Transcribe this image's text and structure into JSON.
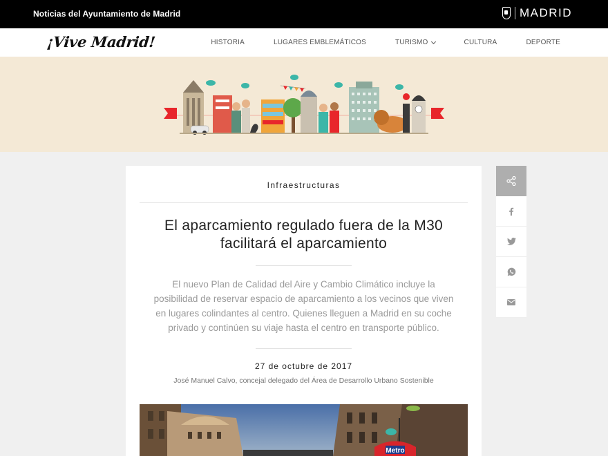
{
  "topbar": {
    "title": "Noticias del Ayuntamiento de Madrid",
    "brand": "MADRID",
    "crest_icon": "madrid-crest-icon"
  },
  "navbar": {
    "logo": "¡Vive Madrid!",
    "menu": [
      {
        "label": "HISTORIA"
      },
      {
        "label": "LUGARES EMBLEMÁTICOS"
      },
      {
        "label": "TURISMO",
        "has_dropdown": true
      },
      {
        "label": "CULTURA"
      },
      {
        "label": "DEPORTE"
      }
    ]
  },
  "banner": {
    "illustration": "madrid-skyline-illustration",
    "background": "#f4e9d6",
    "flag_color": "#e8262b"
  },
  "article": {
    "category": "Infraestructuras",
    "headline": "El aparcamiento regulado fuera de la M30 facilitará el aparcamiento",
    "lead": "El nuevo Plan de Calidad del Aire y Cambio Climático incluye la posibilidad de reservar espacio de aparcamiento a los vecinos que viven en lugares colindantes al centro. Quienes lleguen a Madrid en su coche privado y continúen su viaje hasta el centro en transporte público.",
    "date": "27 de octubre de 2017",
    "author": "José Manuel Calvo, concejal delegado del Área de Desarrollo Urbano Sostenible",
    "photo": {
      "sign_text": "Metro",
      "sign_color": "#d8252b"
    }
  },
  "share": {
    "buttons": [
      {
        "icon": "share-icon"
      },
      {
        "icon": "facebook-icon"
      },
      {
        "icon": "twitter-icon"
      },
      {
        "icon": "whatsapp-icon"
      },
      {
        "icon": "email-icon"
      }
    ]
  },
  "colors": {
    "topbar": "#000000",
    "page_background": "#f0f0f0",
    "share_active": "#aeaeae",
    "lead_text": "#9a9a9a"
  }
}
